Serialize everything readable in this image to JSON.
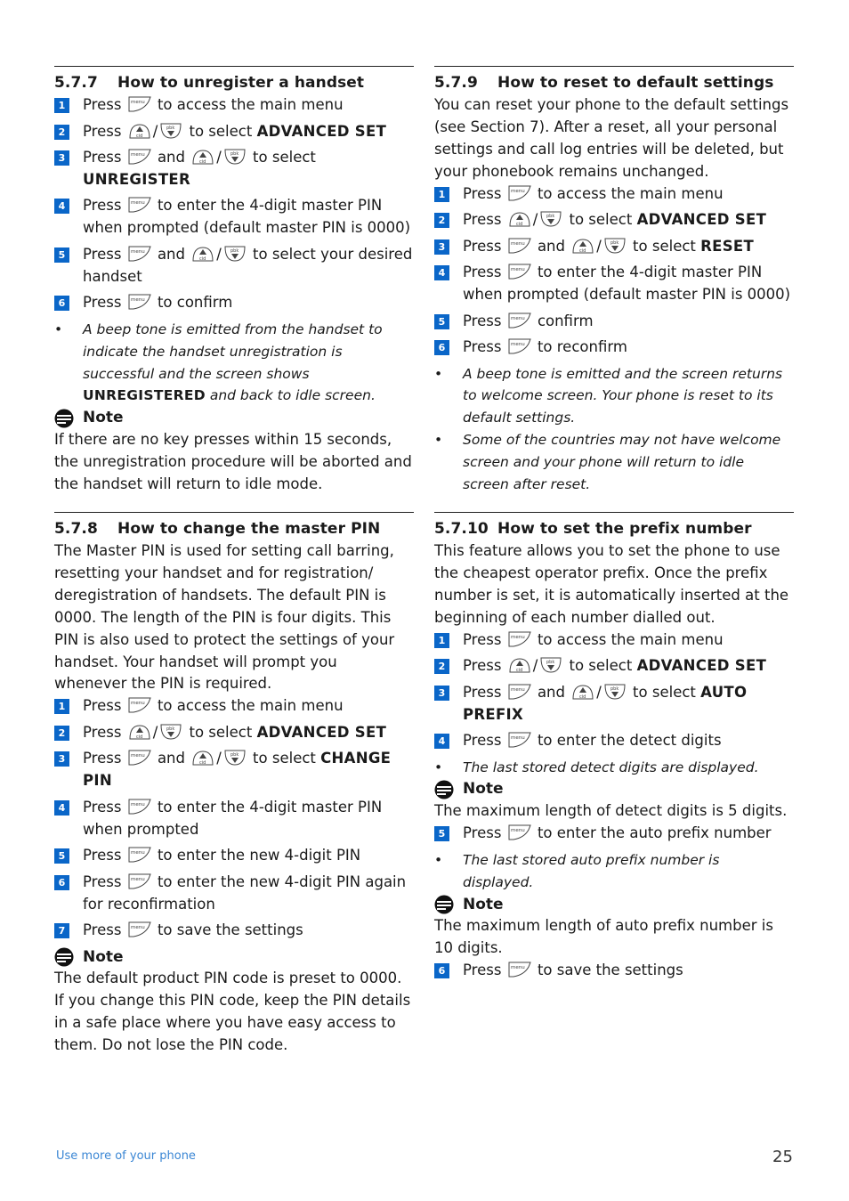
{
  "sections": {
    "s577": {
      "number": "5.7.7",
      "title": "How to unregister a handset",
      "steps": [
        {
          "n": "1",
          "pre": "Press",
          "keys": "menu",
          "post": "to access the main menu"
        },
        {
          "n": "2",
          "pre": "Press",
          "keys": "nav",
          "post": "to select",
          "bold": "ADVANCED SET"
        },
        {
          "n": "3",
          "pre": "Press",
          "and": "and",
          "post": "to select",
          "bold": "UNREGISTER"
        },
        {
          "n": "4",
          "pre": "Press",
          "post": "to enter the 4-digit master PIN when prompted (default master PIN is 0000)"
        },
        {
          "n": "5",
          "pre": "Press",
          "and": "and",
          "post": "to select your desired handset"
        },
        {
          "n": "6",
          "pre": "Press",
          "post": "to confirm"
        }
      ],
      "bullet": {
        "pre": "A beep tone is emitted from the handset to indicate the handset unregistration is successful and the screen shows",
        "bold": "UNREGISTERED",
        "post": "and back to idle screen."
      },
      "note_label": "Note",
      "note": "If there are no key presses within 15 seconds, the unregistration procedure will be aborted and the handset will return to idle mode."
    },
    "s578": {
      "number": "5.7.8",
      "title": "How to change the master PIN",
      "intro": "The Master PIN is used for setting call barring, resetting your handset and for registration/ deregistration of handsets. The default PIN is 0000. The length of the PIN is four digits. This PIN is also used to protect the settings of your handset. Your handset will prompt you whenever the PIN is required.",
      "steps": [
        {
          "n": "1",
          "pre": "Press",
          "post": "to access the main menu"
        },
        {
          "n": "2",
          "pre": "Press",
          "post": "to select",
          "bold": "ADVANCED SET"
        },
        {
          "n": "3",
          "pre": "Press",
          "and": "and",
          "post": "to select",
          "bold": "CHANGE PIN"
        },
        {
          "n": "4",
          "pre": "Press",
          "post": "to enter the 4-digit master PIN when prompted"
        },
        {
          "n": "5",
          "pre": "Press",
          "post": "to enter the new 4-digit PIN"
        },
        {
          "n": "6",
          "pre": "Press",
          "post": "to enter the new 4-digit PIN again for reconfirmation"
        },
        {
          "n": "7",
          "pre": "Press",
          "post": "to save the settings"
        }
      ],
      "note_label": "Note",
      "note": "The default product PIN code is preset to 0000. If you change this PIN code, keep the PIN details in a safe place where you have easy access to them. Do not lose the PIN code."
    },
    "s579": {
      "number": "5.7.9",
      "title": "How to reset to default settings",
      "intro": "You can reset your phone to the default settings (see Section 7). After a reset, all your personal settings and call log entries will be deleted, but your phonebook remains unchanged.",
      "steps": [
        {
          "n": "1",
          "pre": "Press",
          "post": "to access the main menu"
        },
        {
          "n": "2",
          "pre": "Press",
          "post": "to select",
          "bold": "ADVANCED SET"
        },
        {
          "n": "3",
          "pre": "Press",
          "and": "and",
          "post": "to select",
          "bold": "RESET"
        },
        {
          "n": "4",
          "pre": "Press",
          "post": "to enter the 4-digit master PIN when prompted (default master PIN is 0000)"
        },
        {
          "n": "5",
          "pre": "Press",
          "post": "confirm"
        },
        {
          "n": "6",
          "pre": "Press",
          "post": "to reconfirm"
        }
      ],
      "bullets": [
        "A beep tone is emitted and the screen returns to welcome screen. Your phone is reset to its default settings.",
        "Some of the countries may not have welcome screen and your phone will return to idle screen after reset."
      ]
    },
    "s5710": {
      "number": "5.7.10",
      "title": "How to set the prefix number",
      "intro": "This feature allows you to set the phone to use the cheapest operator prefix. Once the prefix number is set, it is automatically inserted at the beginning of each number dialled out.",
      "steps": [
        {
          "n": "1",
          "pre": "Press",
          "post": "to access the main menu"
        },
        {
          "n": "2",
          "pre": "Press",
          "post": "to select",
          "bold": "ADVANCED SET"
        },
        {
          "n": "3",
          "pre": "Press",
          "and": "and",
          "post": "to select",
          "bold": "AUTO PREFIX"
        },
        {
          "n": "4",
          "pre": "Press",
          "post": "to enter the detect digits"
        },
        {
          "n": "5",
          "pre": "Press",
          "post": "to enter the auto prefix number"
        },
        {
          "n": "6",
          "pre": "Press",
          "post": "to save the settings"
        }
      ],
      "bullet1": "The last stored detect digits are displayed.",
      "note1_label": "Note",
      "note1": "The maximum length of detect digits is 5 digits.",
      "bullet2": "The last stored auto prefix number is displayed.",
      "note2_label": "Note",
      "note2": "The maximum length of auto prefix number is 10 digits."
    }
  },
  "icons": {
    "menu_key": "menu-key-icon",
    "up_key": "cid-up-key-icon",
    "down_key": "pbk-down-key-icon",
    "note": "note-icon"
  },
  "colors": {
    "badge": "#0a66c8",
    "footer": "#3a86d4"
  },
  "footer": {
    "chapter": "Use more of your phone",
    "page": "25"
  }
}
